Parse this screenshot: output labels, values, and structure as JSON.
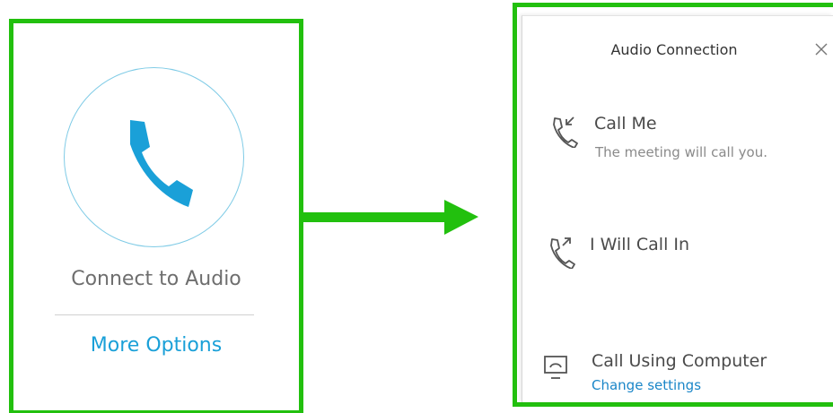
{
  "left_panel": {
    "connect_label": "Connect to Audio",
    "more_options_label": "More Options",
    "phone_icon": "phone-icon",
    "accent_color": "#1aa0d8"
  },
  "arrow_icon": "right-arrow-icon",
  "highlight_color": "#22c00e",
  "dialog": {
    "title": "Audio Connection",
    "close_icon": "close-icon",
    "options": [
      {
        "title": "Call Me",
        "subtitle": "The meeting will call you.",
        "icon": "incoming-call-icon"
      },
      {
        "title": "I Will Call In",
        "icon": "outgoing-call-icon"
      },
      {
        "title": "Call Using Computer",
        "link": "Change settings",
        "icon": "computer-call-icon"
      }
    ]
  }
}
